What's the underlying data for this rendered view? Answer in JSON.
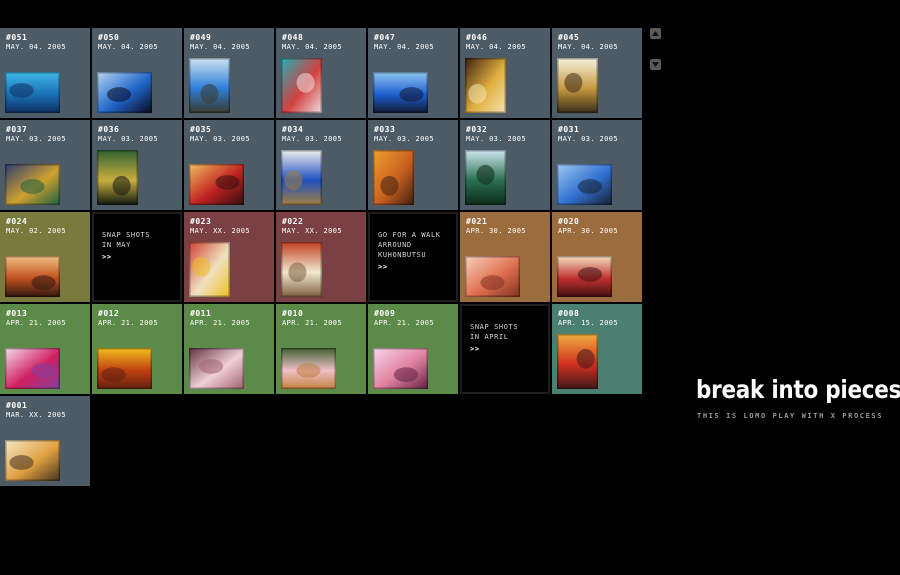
{
  "site": {
    "title": "break into pieces",
    "tagline": "THIS IS LOMO PLAY WITH X PROCESS"
  },
  "colors": {
    "blue": "#4d5b66",
    "olive": "#7a7a3f",
    "maroon": "#7a4044",
    "orange": "#9b6c3e",
    "green": "#5c8a48",
    "teal": "#4b7f72"
  },
  "scroll": {
    "up_icon": "triangle-up-icon",
    "down_icon": "triangle-down-icon"
  },
  "rows": [
    [
      {
        "type": "photo",
        "num": "#051",
        "date": "MAY. 04. 2005",
        "color": "blue",
        "thumb": "landscape",
        "palette": [
          "#1a6fb5",
          "#3fb8e8",
          "#0c2f5e"
        ]
      },
      {
        "type": "photo",
        "num": "#050",
        "date": "MAY. 04. 2005",
        "color": "blue",
        "thumb": "landscape",
        "palette": [
          "#2066c9",
          "#b6d6f0",
          "#0a0a1e"
        ]
      },
      {
        "type": "photo",
        "num": "#049",
        "date": "MAY. 04. 2005",
        "color": "blue",
        "thumb": "portrait",
        "palette": [
          "#2f7ed8",
          "#cfe3f2",
          "#3a3a2a"
        ]
      },
      {
        "type": "photo",
        "num": "#048",
        "date": "MAY. 04. 2005",
        "color": "blue",
        "thumb": "portrait",
        "palette": [
          "#d24040",
          "#20b0b8",
          "#f0e0e0"
        ]
      },
      {
        "type": "photo",
        "num": "#047",
        "date": "MAY. 04. 2005",
        "color": "blue",
        "thumb": "landscape",
        "palette": [
          "#1e5fd0",
          "#8fc6f0",
          "#101830"
        ]
      },
      {
        "type": "photo",
        "num": "#046",
        "date": "MAY. 04. 2005",
        "color": "blue",
        "thumb": "portrait",
        "palette": [
          "#e0b040",
          "#3a2010",
          "#f4e4b0"
        ]
      },
      {
        "type": "photo",
        "num": "#045",
        "date": "MAY. 04. 2005",
        "color": "blue",
        "thumb": "portrait",
        "palette": [
          "#c89a40",
          "#f6f2e0",
          "#3a2c18"
        ]
      }
    ],
    [
      {
        "type": "photo",
        "num": "#037",
        "date": "MAY. 03. 2005",
        "color": "blue",
        "thumb": "landscape",
        "palette": [
          "#d0a030",
          "#2a3c70",
          "#1a6040"
        ]
      },
      {
        "type": "photo",
        "num": "#036",
        "date": "MAY. 03. 2005",
        "color": "blue",
        "thumb": "portrait",
        "palette": [
          "#c8b040",
          "#306030",
          "#101810"
        ]
      },
      {
        "type": "photo",
        "num": "#035",
        "date": "MAY. 03. 2005",
        "color": "blue",
        "thumb": "landscape",
        "palette": [
          "#c02020",
          "#f0c060",
          "#301010"
        ]
      },
      {
        "type": "photo",
        "num": "#034",
        "date": "MAY. 03. 2005",
        "color": "blue",
        "thumb": "portrait",
        "palette": [
          "#2050c0",
          "#f0f0f0",
          "#a08040"
        ]
      },
      {
        "type": "photo",
        "num": "#033",
        "date": "MAY. 03. 2005",
        "color": "blue",
        "thumb": "portrait",
        "palette": [
          "#c86020",
          "#f0a030",
          "#402010"
        ]
      },
      {
        "type": "photo",
        "num": "#032",
        "date": "MAY. 03. 2005",
        "color": "blue",
        "thumb": "portrait",
        "palette": [
          "#2a7050",
          "#d0e8f0",
          "#0c2a18"
        ]
      },
      {
        "type": "photo",
        "num": "#031",
        "date": "MAY. 03. 2005",
        "color": "blue",
        "thumb": "landscape",
        "palette": [
          "#3070d0",
          "#a0c8f0",
          "#1a2030"
        ]
      }
    ],
    [
      {
        "type": "photo",
        "num": "#024",
        "date": "MAY. 02. 2005",
        "color": "olive",
        "thumb": "landscape",
        "palette": [
          "#c05020",
          "#f0c080",
          "#301810"
        ]
      },
      {
        "type": "text",
        "caption": "SNAP SHOTS\nIN MAY",
        "more": ">>"
      },
      {
        "type": "photo",
        "num": "#023",
        "date": "MAY. XX. 2005",
        "color": "maroon",
        "thumb": "portrait",
        "palette": [
          "#f0e0c0",
          "#d04030",
          "#f0c020"
        ]
      },
      {
        "type": "photo",
        "num": "#022",
        "date": "MAY. XX. 2005",
        "color": "maroon",
        "thumb": "portrait",
        "palette": [
          "#f0e8d0",
          "#c04020",
          "#806040"
        ]
      },
      {
        "type": "text",
        "caption": "GO FOR A WALK\nARROUND\nKUHONBUTSU",
        "more": ">>"
      },
      {
        "type": "photo",
        "num": "#021",
        "date": "APR. 30. 2005",
        "color": "orange",
        "thumb": "landscape",
        "palette": [
          "#e07050",
          "#f8d0c0",
          "#803020"
        ]
      },
      {
        "type": "photo",
        "num": "#020",
        "date": "APR. 30. 2005",
        "color": "orange",
        "thumb": "landscape",
        "palette": [
          "#c03030",
          "#f4e0c0",
          "#401010"
        ]
      }
    ],
    [
      {
        "type": "photo",
        "num": "#013",
        "date": "APR. 21. 2005",
        "color": "green",
        "thumb": "landscape",
        "palette": [
          "#d02060",
          "#f4e0f0",
          "#8040a0"
        ]
      },
      {
        "type": "photo",
        "num": "#012",
        "date": "APR. 21. 2005",
        "color": "green",
        "thumb": "landscape",
        "palette": [
          "#c04010",
          "#f0c020",
          "#602010"
        ]
      },
      {
        "type": "photo",
        "num": "#011",
        "date": "APR. 21. 2005",
        "color": "green",
        "thumb": "landscape",
        "palette": [
          "#f0d0d8",
          "#603040",
          "#a06070"
        ]
      },
      {
        "type": "photo",
        "num": "#010",
        "date": "APR. 21. 2005",
        "color": "green",
        "thumb": "landscape",
        "palette": [
          "#f0c0c8",
          "#406030",
          "#c08040"
        ]
      },
      {
        "type": "photo",
        "num": "#009",
        "date": "APR. 21. 2005",
        "color": "green",
        "thumb": "landscape",
        "palette": [
          "#e080a0",
          "#f8d8e8",
          "#602040"
        ]
      },
      {
        "type": "text",
        "caption": "SNAP SHOTS\nIN APRIL",
        "more": ">>"
      },
      {
        "type": "photo",
        "num": "#008",
        "date": "APR. 15. 2005",
        "color": "teal",
        "thumb": "portrait",
        "palette": [
          "#d03020",
          "#f0b040",
          "#401818"
        ]
      }
    ],
    [
      {
        "type": "photo",
        "num": "#001",
        "date": "MAR. XX. 2005",
        "color": "blue",
        "thumb": "landscape",
        "palette": [
          "#e0a040",
          "#f6e8c8",
          "#403020"
        ]
      }
    ]
  ]
}
